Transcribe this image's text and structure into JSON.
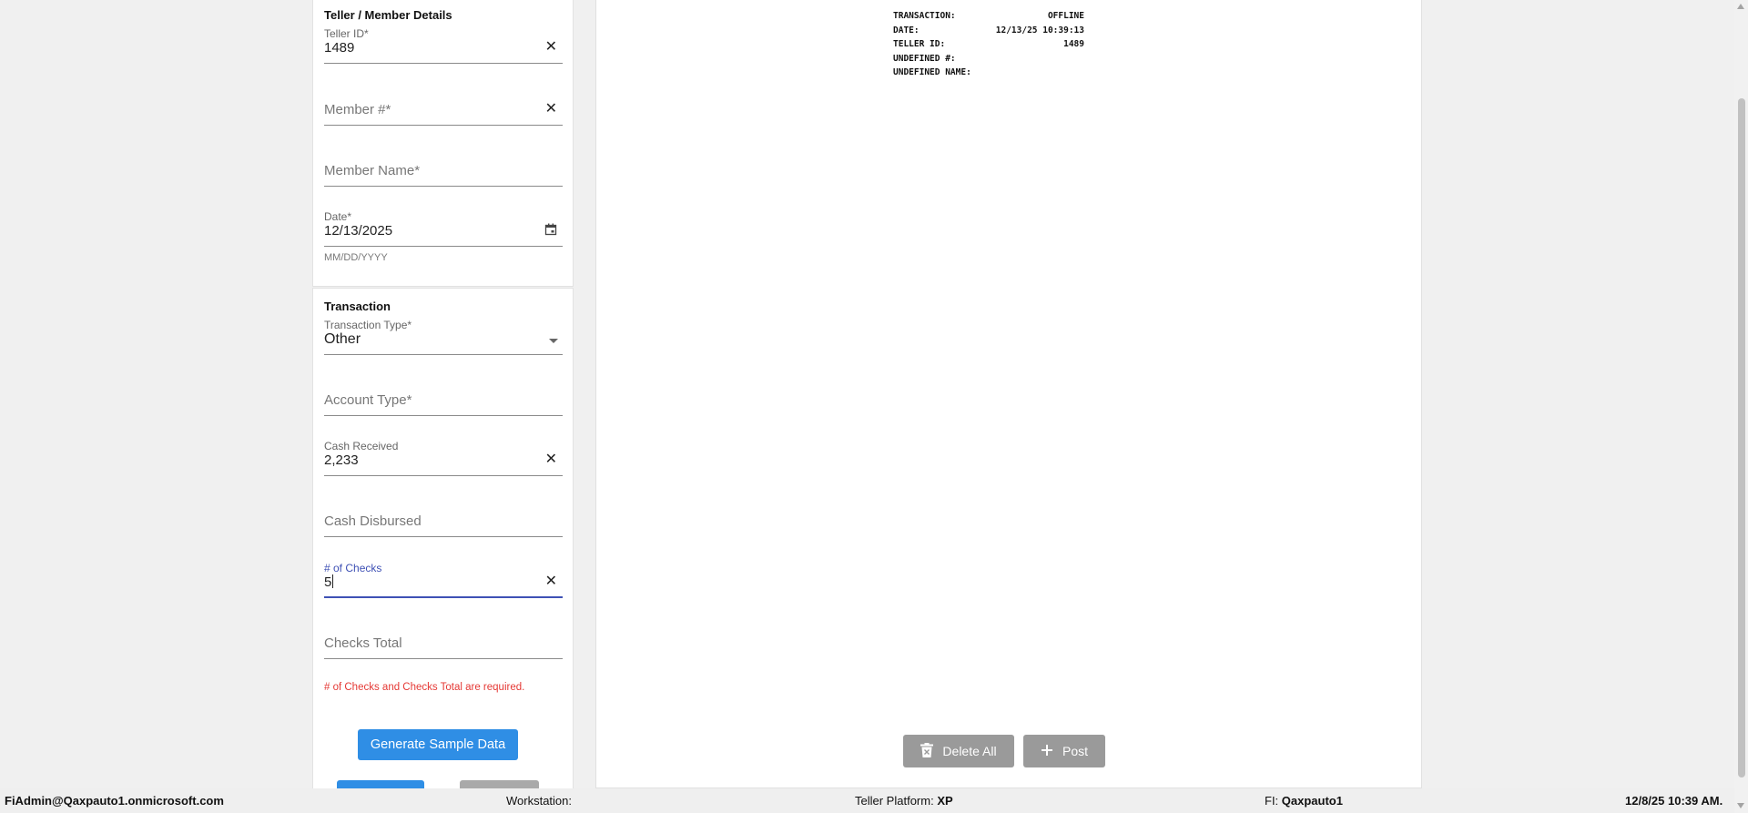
{
  "teller_section": {
    "title": "Teller / Member Details",
    "teller_id": {
      "label": "Teller ID*",
      "value": "1489"
    },
    "member_number": {
      "placeholder": "Member #*"
    },
    "member_name": {
      "placeholder": "Member Name*"
    },
    "date": {
      "label": "Date*",
      "value": "12/13/2025",
      "hint": "MM/DD/YYYY"
    }
  },
  "transaction_section": {
    "title": "Transaction",
    "transaction_type": {
      "label": "Transaction Type*",
      "value": "Other"
    },
    "account_type": {
      "placeholder": "Account Type*"
    },
    "cash_received": {
      "label": "Cash Received",
      "value": "2,233"
    },
    "cash_disbursed": {
      "placeholder": "Cash Disbursed"
    },
    "num_checks": {
      "label": "# of Checks",
      "value": "5"
    },
    "checks_total": {
      "placeholder": "Checks Total"
    },
    "error": "# of Checks and Checks Total are required.",
    "generate_button": "Generate Sample Data"
  },
  "receipt": [
    {
      "label": "TRANSACTION:",
      "value": "OFFLINE"
    },
    {
      "label": "DATE:",
      "value": "12/13/25 10:39:13"
    },
    {
      "label": "TELLER ID:",
      "value": "1489"
    },
    {
      "label": "UNDEFINED #:",
      "value": ""
    },
    {
      "label": "UNDEFINED NAME:",
      "value": ""
    }
  ],
  "actions": {
    "delete_all": "Delete All",
    "post": "Post"
  },
  "icons": {
    "clear": "close-icon",
    "calendar": "calendar-icon",
    "dropdown": "dropdown-arrow-icon",
    "trash": "trash-icon",
    "plus": "plus-icon"
  },
  "colors": {
    "primary": "#2f8ee5",
    "focus": "#3f51b5",
    "error": "#e53935",
    "disabled": "#9a9a9a"
  },
  "status_bar": {
    "user": "FiAdmin@Qaxpauto1.onmicrosoft.com",
    "workstation_label": "Workstation:",
    "platform_label": "Teller Platform:",
    "platform_value": "XP",
    "fi_label": "FI:",
    "fi_value": "Qaxpauto1",
    "datetime": "12/8/25 10:39 AM."
  }
}
